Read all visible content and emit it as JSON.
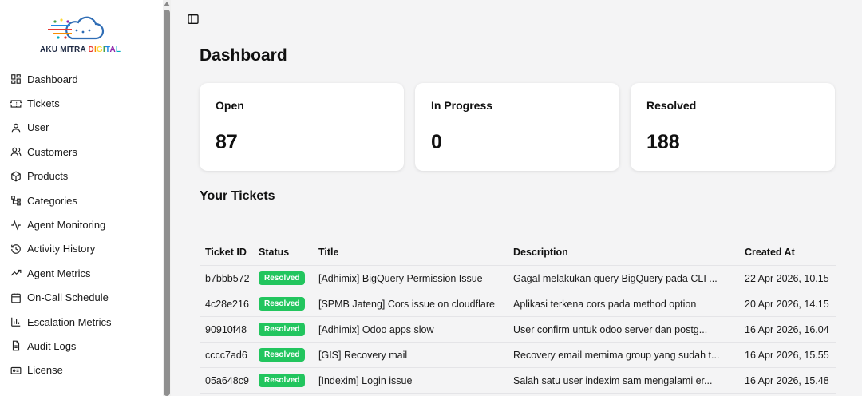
{
  "brand": {
    "logo_text": [
      "AKU MITRA ",
      "D",
      "I",
      "G",
      "I",
      "T",
      "A",
      "L"
    ]
  },
  "sidebar": {
    "items": [
      {
        "label": "Dashboard",
        "icon": "dashboard-icon"
      },
      {
        "label": "Tickets",
        "icon": "ticket-icon"
      },
      {
        "label": "User",
        "icon": "user-icon"
      },
      {
        "label": "Customers",
        "icon": "users-icon"
      },
      {
        "label": "Products",
        "icon": "box-icon"
      },
      {
        "label": "Categories",
        "icon": "tree-icon"
      },
      {
        "label": "Agent Monitoring",
        "icon": "activity-icon"
      },
      {
        "label": "Activity History",
        "icon": "history-icon"
      },
      {
        "label": "Agent Metrics",
        "icon": "trend-icon"
      },
      {
        "label": "On-Call Schedule",
        "icon": "calendar-icon"
      },
      {
        "label": "Escalation Metrics",
        "icon": "bar-chart-icon"
      },
      {
        "label": "Audit Logs",
        "icon": "file-text-icon"
      },
      {
        "label": "License",
        "icon": "license-icon"
      }
    ]
  },
  "main": {
    "title": "Dashboard",
    "cards": [
      {
        "label": "Open",
        "value": "87"
      },
      {
        "label": "In Progress",
        "value": "0"
      },
      {
        "label": "Resolved",
        "value": "188"
      }
    ],
    "tickets_title": "Your Tickets",
    "table": {
      "columns": [
        "Ticket ID",
        "Status",
        "Title",
        "Description",
        "Created At"
      ],
      "rows": [
        {
          "id": "b7bbb572",
          "status": "Resolved",
          "title": "[Adhimix] BigQuery Permission Issue",
          "description": "Gagal melakukan query BigQuery pada CLI ...",
          "created": "22 Apr 2026, 10.15"
        },
        {
          "id": "4c28e216",
          "status": "Resolved",
          "title": "[SPMB Jateng] Cors issue on cloudflare",
          "description": "Aplikasi terkena cors pada method option",
          "created": "20 Apr 2026, 14.15"
        },
        {
          "id": "90910f48",
          "status": "Resolved",
          "title": "[Adhimix] Odoo apps slow",
          "description": "User confirm untuk odoo server dan postg...",
          "created": "16 Apr 2026, 16.04"
        },
        {
          "id": "cccc7ad6",
          "status": "Resolved",
          "title": "[GIS] Recovery mail",
          "description": "Recovery email memima group yang sudah t...",
          "created": "16 Apr 2026, 15.55"
        },
        {
          "id": "05a648c9",
          "status": "Resolved",
          "title": "[Indexim] Login issue",
          "description": "Salah satu user indexim sam mengalami er...",
          "created": "16 Apr 2026, 15.48"
        }
      ]
    }
  },
  "colors": {
    "accent_green": "#22c55e",
    "background": "#f4f4f5",
    "card": "#ffffff"
  }
}
